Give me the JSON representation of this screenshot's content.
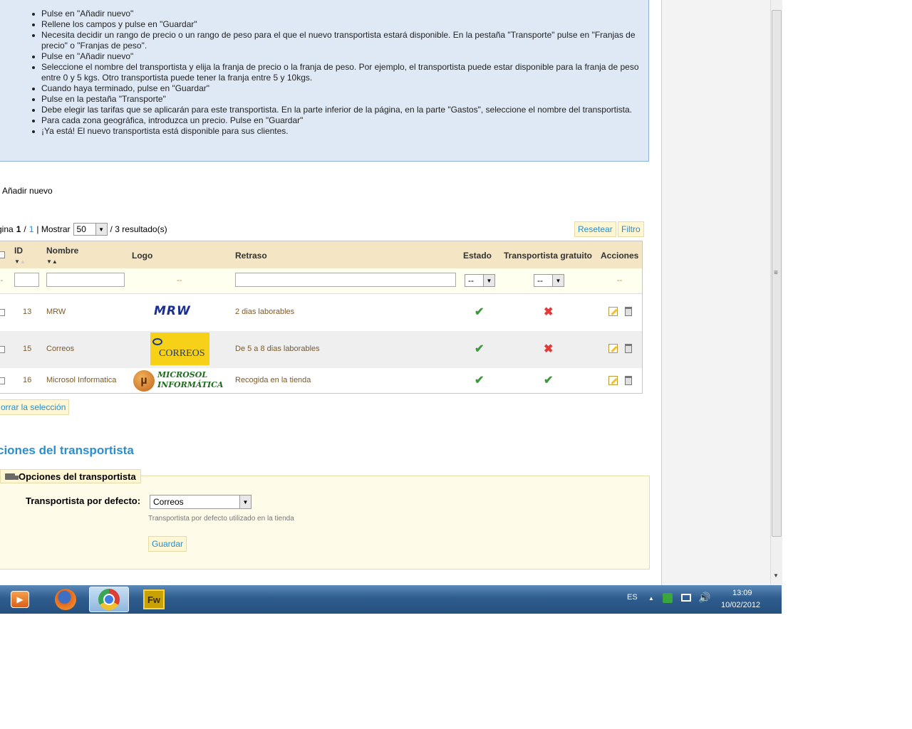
{
  "help": {
    "steps": [
      "Pulse en \"Añadir nuevo\"",
      "Rellene los campos y pulse en \"Guardar\"",
      "Necesita decidir un rango de precio o un rango de peso para el que el nuevo transportista estará disponible. En la pestaña \"Transporte\" pulse en \"Franjas de precio\" o \"Franjas de peso\".",
      "Pulse en \"Añadir nuevo\"",
      "Seleccione el nombre del transportista y elija la franja de precio o la franja de peso. Por ejemplo, el transportista puede estar disponible para la franja de peso entre 0 y 5 kgs. Otro transportista puede tener la franja entre 5 y 10kgs.",
      "Cuando haya terminado, pulse en \"Guardar\"",
      "Pulse en la pestaña \"Transporte\"",
      "Debe elegir las tarifas que se aplicarán para este transportista. En la parte inferior de la página, en la parte \"Gastos\", seleccione el nombre del transportista.",
      "Para cada zona geográfica, introduzca un precio. Pulse en \"Guardar\"",
      "¡Ya está! El nuevo transportista está disponible para sus clientes."
    ]
  },
  "toolbar": {
    "add_new": "Añadir nuevo"
  },
  "pager": {
    "prefix": "gina",
    "page": "1",
    "sep": "/",
    "total_pages": "1",
    "show_label": "| Mostrar",
    "per_page": "50",
    "results": "/ 3 resultado(s)",
    "reset": "Resetear",
    "filter": "Filtro"
  },
  "table": {
    "headers": {
      "id": "ID",
      "name": "Nombre",
      "logo": "Logo",
      "delay": "Retraso",
      "status": "Estado",
      "free": "Transportista gratuito",
      "actions": "Acciones"
    },
    "filter_dash": "--",
    "rows": [
      {
        "id": "13",
        "name": "MRW",
        "logo_text": "MRW",
        "delay": "2 dias laborables",
        "status": "active",
        "free": "no"
      },
      {
        "id": "15",
        "name": "Correos",
        "logo_text": "CORREOS",
        "delay": "De 5 a 8 dias laborables",
        "status": "active",
        "free": "no"
      },
      {
        "id": "16",
        "name": "Microsol Informatica",
        "logo_text": "MICROSOL INFORMÁTICA",
        "delay": "Recogida en la tienda",
        "status": "active",
        "free": "yes"
      }
    ]
  },
  "bulk": {
    "delete_selected": "orrar la selección"
  },
  "options": {
    "section_title": "ciones del transportista",
    "legend": "Opciones del transportista",
    "default_label": "Transportista por defecto:",
    "default_value": "Correos",
    "hint": "Transportista por defecto utilizado en la tienda",
    "save": "Guardar"
  },
  "taskbar": {
    "lang": "ES",
    "time": "13:09",
    "date": "10/02/2012",
    "apps": [
      "media-player",
      "firefox",
      "chrome",
      "fireworks"
    ],
    "fw_label": "Fw"
  },
  "colors": {
    "accent": "#268ccd",
    "header_bg": "#f4e6c5",
    "info_bg": "#dfe9f5"
  }
}
